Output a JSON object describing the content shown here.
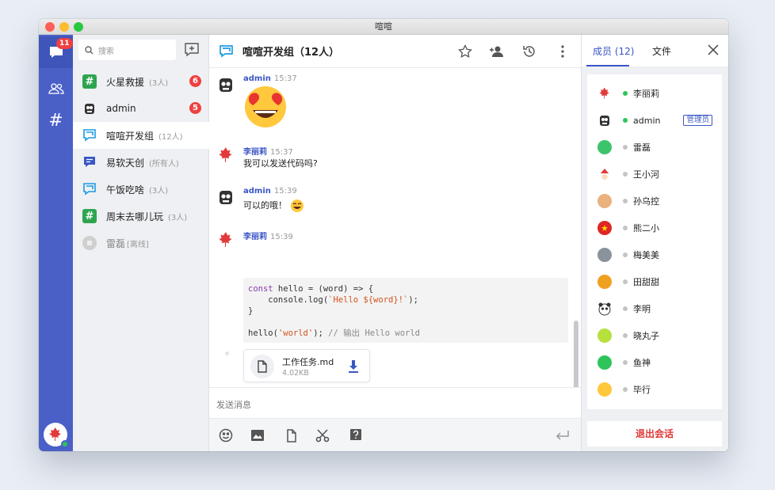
{
  "window": {
    "title": "喧喧"
  },
  "rail": {
    "unread_badge": "11"
  },
  "search": {
    "placeholder": "搜索"
  },
  "conversations": [
    {
      "name": "火星救援",
      "count": "(3人)",
      "badge": "6",
      "icon": "hash-icon",
      "color": "#2ea44f"
    },
    {
      "name": "admin",
      "count": "",
      "badge": "5",
      "icon": "robot-avatar",
      "color": "#333333"
    },
    {
      "name": "喧喧开发组",
      "count": "(12人)",
      "badge": "",
      "icon": "chat-icon",
      "color": "#1e9be0"
    },
    {
      "name": "易软天创",
      "count": "(所有人)",
      "badge": "",
      "icon": "message-icon",
      "color": "#3a56c5"
    },
    {
      "name": "午饭吃啥",
      "count": "(3人)",
      "badge": "",
      "icon": "chat-icon",
      "color": "#1e9be0"
    },
    {
      "name": "周末去哪儿玩",
      "count": "(3人)",
      "badge": "",
      "icon": "hash-icon",
      "color": "#2ea44f"
    },
    {
      "name": "雷磊",
      "count": "[离线]",
      "badge": "",
      "icon": "user-avatar",
      "color": "#cfcfcf"
    }
  ],
  "chat": {
    "title": "喧喧开发组（12人）",
    "messages": [
      {
        "author": "admin",
        "time": "15:37",
        "text": ""
      },
      {
        "author": "李丽莉",
        "time": "15:37",
        "text": "我可以发送代码吗?"
      },
      {
        "author": "admin",
        "time": "15:39",
        "text": "可以的哦！"
      },
      {
        "author": "李丽莉",
        "time": "15:39",
        "text": ""
      }
    ],
    "code": {
      "line1_a": "const",
      "line1_b": " hello = (word) => {",
      "line2_a": "    console.log(",
      "line2_b": "`Hello ${word}!`",
      "line2_c": ");",
      "line3": "}",
      "line5_a": "hello(",
      "line5_b": "'world'",
      "line5_c": "); ",
      "line5_d": "// 输出 Hello world"
    },
    "file": {
      "name": "工作任务.md",
      "size": "4.02KB"
    },
    "composer_placeholder": "发送消息"
  },
  "panel": {
    "tab_members": "成员 (12)",
    "tab_files": "文件",
    "admin_tag": "管理员",
    "exit_label": "退出会话",
    "members": [
      {
        "name": "李丽莉",
        "online": true
      },
      {
        "name": "admin",
        "online": true
      },
      {
        "name": "雷磊",
        "online": false
      },
      {
        "name": "王小河",
        "online": false
      },
      {
        "name": "孙乌控",
        "online": false
      },
      {
        "name": "熊二小",
        "online": false
      },
      {
        "name": "梅美美",
        "online": false
      },
      {
        "name": "田甜甜",
        "online": false
      },
      {
        "name": "李明",
        "online": false
      },
      {
        "name": "晓丸子",
        "online": false
      },
      {
        "name": "鱼神",
        "online": false
      },
      {
        "name": "毕行",
        "online": false
      }
    ]
  },
  "colors": {
    "accent": "#3a56c5",
    "rail": "#4a60c7",
    "badge": "#f04040",
    "online": "#2ec45a",
    "offline": "#c4c4c4",
    "danger": "#e03838"
  }
}
